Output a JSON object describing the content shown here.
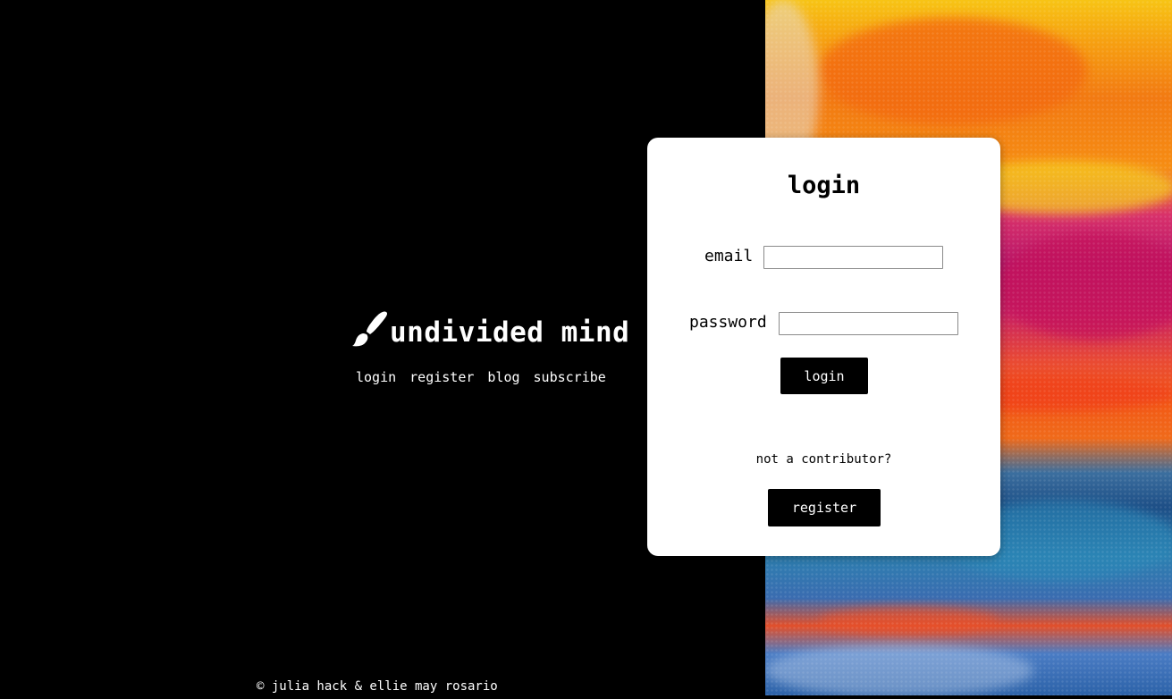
{
  "brand": {
    "title": "undivided mind",
    "icon": "paintbrush-icon"
  },
  "nav": {
    "items": [
      {
        "label": "login"
      },
      {
        "label": "register"
      },
      {
        "label": "blog"
      },
      {
        "label": "subscribe"
      }
    ]
  },
  "login_card": {
    "title": "login",
    "email_label": "email",
    "email_value": "",
    "password_label": "password",
    "password_value": "",
    "login_button": "login",
    "not_contributor_text": "not a contributor?",
    "register_button": "register"
  },
  "footer": {
    "text": "© julia hack & ellie may rosario"
  },
  "colors": {
    "background": "#000000",
    "card": "#ffffff",
    "button": "#000000",
    "button_text": "#ffffff"
  }
}
